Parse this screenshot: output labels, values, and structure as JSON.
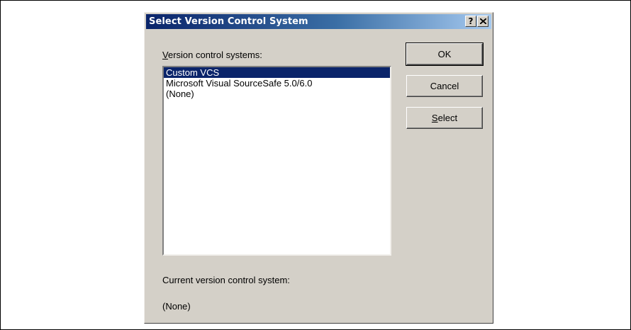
{
  "dialog": {
    "title": "Select Version Control System",
    "help_button": "?",
    "close_icon": "close-icon"
  },
  "list": {
    "label_prefix": "",
    "label_accel": "V",
    "label_rest": "ersion control systems:",
    "items": [
      {
        "label": "Custom VCS",
        "selected": true
      },
      {
        "label": "Microsoft Visual SourceSafe 5.0/6.0",
        "selected": false
      },
      {
        "label": "(None)",
        "selected": false
      }
    ]
  },
  "buttons": {
    "ok": "OK",
    "cancel": "Cancel",
    "select_accel": "S",
    "select_rest": "elect"
  },
  "current": {
    "label": "Current version control system:",
    "value": "(None)"
  },
  "colors": {
    "selection": "#0a246a",
    "dialog_bg": "#d4d0c8"
  }
}
